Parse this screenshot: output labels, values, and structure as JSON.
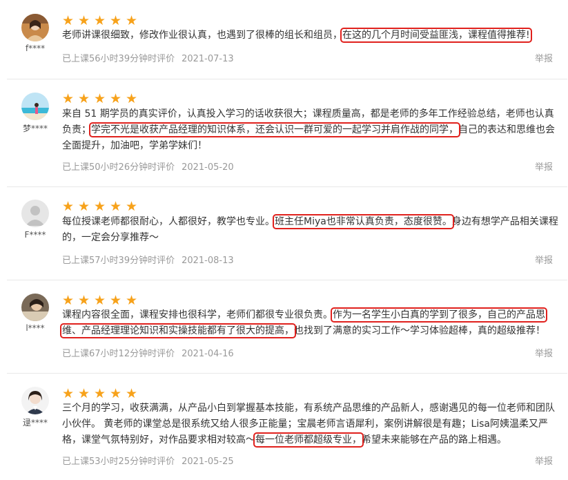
{
  "report_label": "举报",
  "star_glyph": "★",
  "colors": {
    "star": "#f7a21b",
    "highlight": "#e0201c"
  },
  "reviews": [
    {
      "user": "f****",
      "rating": 5,
      "text_before": "老师讲课很细致，修改作业很认真，也遇到了很棒的组长和组员，",
      "highlight": "在这的几个月时间受益匪浅，课程值得推荐!",
      "text_after": "",
      "meta": "已上课56小时39分钟时评价",
      "date": "2021-07-13"
    },
    {
      "user": "梦****",
      "rating": 5,
      "text_before": "来自 51 期学员的真实评价，认真投入学习的话收获很大；课程质量高，都是老师的多年工作经验总结，老师也认真负责；",
      "highlight": "学完不光是收获产品经理的知识体系，还会认识一群可爱的一起学习并肩作战的同学，",
      "text_after": "自己的表达和思维也会全面提升，加油吧，学弟学妹们！",
      "meta": "已上课50小时26分钟时评价",
      "date": "2021-05-20"
    },
    {
      "user": "F****",
      "rating": 5,
      "text_before": "每位授课老师都很耐心，人都很好，教学也专业。",
      "highlight": "班主任Miya也非常认真负责，态度很赞。",
      "text_after": "身边有想学产品相关课程的，一定会分享推荐～",
      "meta": "已上课57小时39分钟时评价",
      "date": "2021-08-13"
    },
    {
      "user": "l****",
      "rating": 5,
      "text_before": "课程内容很全面，课程安排也很科学，老师们都很专业很负责。",
      "highlight": "作为一名学生小白真的学到了很多，自己的产品思维、产品经理理论知识和实操技能都有了很大的提高，",
      "text_after": "也找到了满意的实习工作～学习体验超棒，真的超级推荐！",
      "meta": "已上课67小时12分钟时评价",
      "date": "2021-04-16"
    },
    {
      "user": "逯****",
      "rating": 5,
      "text_before": "三个月的学习，收获满满，从产品小白到掌握基本技能，有系统产品思维的产品新人，感谢遇见的每一位老师和团队小伙伴。 黄老师的课堂总是很系统又给人很多正能量；宝晨老师言语犀利，案例讲解很是有趣；Lisa阿姨温柔又严格，课堂气氛特别好，对作品要求相对较高～",
      "highlight": "每一位老师都超级专业，",
      "text_after": "希望未来能够在产品的路上相遇。",
      "meta": "已上课53小时25分钟时评价",
      "date": "2021-05-25"
    }
  ]
}
